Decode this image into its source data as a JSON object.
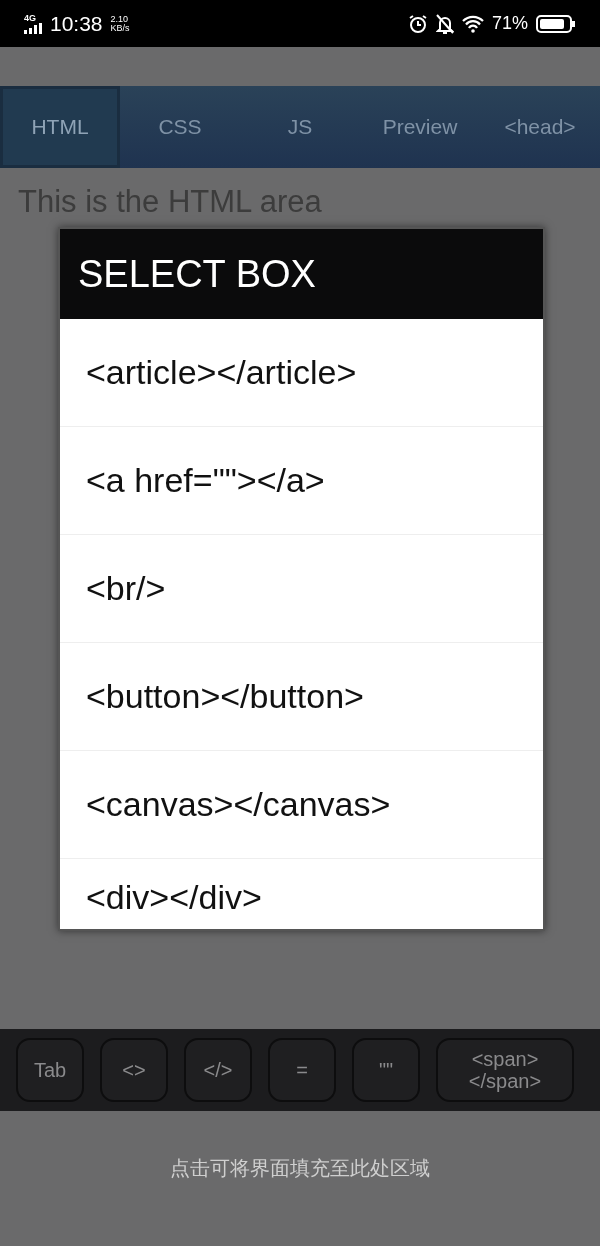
{
  "status_bar": {
    "network": "4G",
    "time": "10:38",
    "speed_value": "2.10",
    "speed_unit": "KB/s",
    "battery_text": "71%"
  },
  "tabs": [
    {
      "label": "HTML",
      "selected": true
    },
    {
      "label": "CSS",
      "selected": false
    },
    {
      "label": "JS",
      "selected": false
    },
    {
      "label": "Preview",
      "selected": false
    },
    {
      "label": "<head>",
      "selected": false
    }
  ],
  "editor": {
    "text": "This is the HTML area"
  },
  "dialog": {
    "title": "SELECT BOX",
    "items": [
      "<article></article>",
      "<a href=\"\"></a>",
      "<br/>",
      "<button></button>",
      "<canvas></canvas>",
      "<div></div>"
    ]
  },
  "keys": [
    "Tab",
    "<>",
    "</>",
    "=",
    "\"\"",
    "<span></span>"
  ],
  "footer": {
    "text": "点击可将界面填充至此处区域"
  }
}
